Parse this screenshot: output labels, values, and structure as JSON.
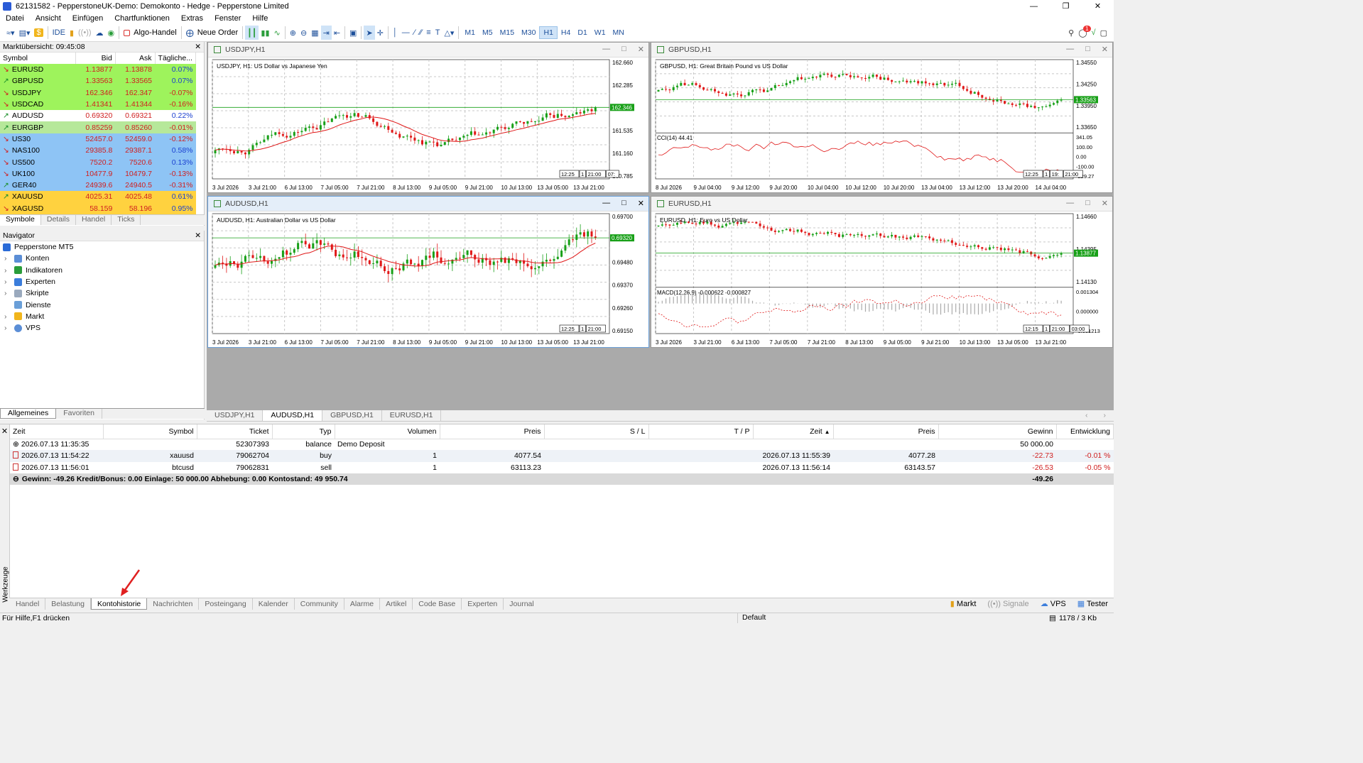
{
  "title": {
    "text": "62131582 - PepperstoneUK-Demo: Demokonto - Hedge - Pepperstone Limited"
  },
  "menu": [
    "Datei",
    "Ansicht",
    "Einfügen",
    "Chartfunktionen",
    "Extras",
    "Fenster",
    "Hilfe"
  ],
  "toolbar": {
    "ide": "IDE",
    "algo": "Algo-Handel",
    "new_order": "Neue Order",
    "timeframes": [
      "M1",
      "M5",
      "M15",
      "M30",
      "H1",
      "H4",
      "D1",
      "W1",
      "MN"
    ],
    "active_tf": "H1",
    "notify_count": "1"
  },
  "market_watch": {
    "title": "Marktübersicht: 09:45:08",
    "headers": [
      "Symbol",
      "Bid",
      "Ask",
      "Tägliche..."
    ],
    "rows": [
      {
        "sym": "EURUSD",
        "bid": "1.13877",
        "ask": "1.13878",
        "chg": "0.07%",
        "bg": "#9ef35c",
        "dir": "down"
      },
      {
        "sym": "GBPUSD",
        "bid": "1.33563",
        "ask": "1.33565",
        "chg": "0.07%",
        "bg": "#9ef35c",
        "dir": "up"
      },
      {
        "sym": "USDJPY",
        "bid": "162.346",
        "ask": "162.347",
        "chg": "-0.07%",
        "bg": "#9ef35c",
        "dir": "down"
      },
      {
        "sym": "USDCAD",
        "bid": "1.41341",
        "ask": "1.41344",
        "chg": "-0.16%",
        "bg": "#9ef35c",
        "dir": "down"
      },
      {
        "sym": "AUDUSD",
        "bid": "0.69320",
        "ask": "0.69321",
        "chg": "0.22%",
        "bg": "#ffffff",
        "dir": "up"
      },
      {
        "sym": "EURGBP",
        "bid": "0.85259",
        "ask": "0.85260",
        "chg": "-0.01%",
        "bg": "#b6e89a",
        "dir": "up"
      },
      {
        "sym": "US30",
        "bid": "52457.0",
        "ask": "52459.0",
        "chg": "-0.12%",
        "bg": "#8ec4f5",
        "dir": "down"
      },
      {
        "sym": "NAS100",
        "bid": "29385.8",
        "ask": "29387.1",
        "chg": "0.58%",
        "bg": "#8ec4f5",
        "dir": "down"
      },
      {
        "sym": "US500",
        "bid": "7520.2",
        "ask": "7520.6",
        "chg": "0.13%",
        "bg": "#8ec4f5",
        "dir": "down"
      },
      {
        "sym": "UK100",
        "bid": "10477.9",
        "ask": "10479.7",
        "chg": "-0.13%",
        "bg": "#8ec4f5",
        "dir": "down"
      },
      {
        "sym": "GER40",
        "bid": "24939.6",
        "ask": "24940.5",
        "chg": "-0.31%",
        "bg": "#8ec4f5",
        "dir": "up"
      },
      {
        "sym": "XAUUSD",
        "bid": "4025.31",
        "ask": "4025.48",
        "chg": "0.61%",
        "bg": "#ffd23f",
        "dir": "up"
      },
      {
        "sym": "XAGUSD",
        "bid": "58.159",
        "ask": "58.196",
        "chg": "0.95%",
        "bg": "#ffd23f",
        "dir": "down"
      }
    ],
    "tabs": [
      "Symbole",
      "Details",
      "Handel",
      "Ticks"
    ]
  },
  "navigator": {
    "title": "Navigator",
    "root": "Pepperstone MT5",
    "items": [
      "Konten",
      "Indikatoren",
      "Experten",
      "Skripte",
      "Dienste",
      "Markt",
      "VPS"
    ],
    "tabs": [
      "Allgemeines",
      "Favoriten"
    ]
  },
  "charts": [
    {
      "title": "USDJPY,H1",
      "label": "USDJPY, H1:  US Dollar vs Japanese Yen",
      "prices": [
        "162.660",
        "162.285",
        "161.910",
        "161.535",
        "161.160",
        "160.785"
      ],
      "last": "162.346",
      "dates": [
        "3 Jul 2026",
        "3 Jul 21:00",
        "6 Jul 13:00",
        "7 Jul 05:00",
        "7 Jul 21:00",
        "8 Jul 13:00",
        "9 Jul 05:00",
        "9 Jul 21:00",
        "10 Jul 13:00",
        "13 Jul 05:00",
        "13 Jul 21:00"
      ],
      "markers": [
        "12:25",
        "1",
        "21:00",
        "07:"
      ]
    },
    {
      "title": "GBPUSD,H1",
      "label": "GBPUSD, H1:  Great Britain Pound vs US Dollar",
      "prices": [
        "1.34550",
        "1.34250",
        "1.33950",
        "1.33650"
      ],
      "last": "1.33563",
      "sub": "CCI(14) 44.41",
      "subprices": [
        "341.05",
        "100.00",
        "0.00",
        "-100.00",
        "-229.27"
      ],
      "dates": [
        "8 Jul 2026",
        "9 Jul 04:00",
        "9 Jul 12:00",
        "9 Jul 20:00",
        "10 Jul 04:00",
        "10 Jul 12:00",
        "10 Jul 20:00",
        "13 Jul 04:00",
        "13 Jul 12:00",
        "13 Jul 20:00",
        "14 Jul 04:00"
      ],
      "markers": [
        "12:25",
        "1",
        "19:",
        "21:00"
      ]
    },
    {
      "title": "AUDUSD,H1",
      "label": "AUDUSD, H1:  Australian Dollar vs US Dollar",
      "prices": [
        "0.69700",
        "0.69590",
        "0.69480",
        "0.69370",
        "0.69260",
        "0.69150"
      ],
      "last": "0.69320",
      "dates": [
        "3 Jul 2026",
        "3 Jul 21:00",
        "6 Jul 13:00",
        "7 Jul 05:00",
        "7 Jul 21:00",
        "8 Jul 13:00",
        "9 Jul 05:00",
        "9 Jul 21:00",
        "10 Jul 13:00",
        "13 Jul 05:00",
        "13 Jul 21:00"
      ],
      "markers": [
        "12:25",
        "1",
        "21:00"
      ]
    },
    {
      "title": "EURUSD,H1",
      "label": "EURUSD, H1:  Euro vs US Dollar",
      "prices": [
        "1.14660",
        "1.14395",
        "1.14130"
      ],
      "last": "1.13877",
      "sub": "MACD(12,26,9) -0.000622 -0.000827",
      "subprices": [
        "0.001304",
        "0.000000",
        "-0.001213"
      ],
      "dates": [
        "3 Jul 2026",
        "3 Jul 21:00",
        "6 Jul 13:00",
        "7 Jul 05:00",
        "7 Jul 21:00",
        "8 Jul 13:00",
        "9 Jul 05:00",
        "9 Jul 21:00",
        "10 Jul 13:00",
        "13 Jul 05:00",
        "13 Jul 21:00"
      ],
      "markers": [
        "12:15",
        "1",
        "21:00",
        "03:00"
      ]
    }
  ],
  "chart_tabs": [
    "USDJPY,H1",
    "AUDUSD,H1",
    "GBPUSD,H1",
    "EURUSD,H1"
  ],
  "active_chart_tab": "AUDUSD,H1",
  "history": {
    "headers": [
      "Zeit",
      "Symbol",
      "Ticket",
      "Typ",
      "Volumen",
      "Preis",
      "S / L",
      "T / P",
      "Zeit",
      "Preis",
      "Gewinn",
      "Entwicklung"
    ],
    "rows": [
      {
        "time": "2026.07.13 11:35:35",
        "symbol": "",
        "ticket": "52307393",
        "type": "balance",
        "vol": "Demo Deposit",
        "price": "",
        "sl": "",
        "tp": "",
        "time2": "",
        "price2": "",
        "profit": "50 000.00",
        "dev": "",
        "red": false
      },
      {
        "time": "2026.07.13 11:54:22",
        "symbol": "xauusd",
        "ticket": "79062704",
        "type": "buy",
        "vol": "1",
        "price": "4077.54",
        "sl": "",
        "tp": "",
        "time2": "2026.07.13 11:55:39",
        "price2": "4077.28",
        "profit": "-22.73",
        "dev": "-0.01 %",
        "red": true
      },
      {
        "time": "2026.07.13 11:56:01",
        "symbol": "btcusd",
        "ticket": "79062831",
        "type": "sell",
        "vol": "1",
        "price": "63113.23",
        "sl": "",
        "tp": "",
        "time2": "2026.07.13 11:56:14",
        "price2": "63143.57",
        "profit": "-26.53",
        "dev": "-0.05 %",
        "red": true
      }
    ],
    "summary": "Gewinn: -49.26  Kredit/Bonus: 0.00  Einlage: 50 000.00  Abhebung: 0.00  Kontostand: 49 950.74",
    "summary_total": "-49.26"
  },
  "toolbox_label": "Werkzeuge",
  "bottom_tabs": [
    "Handel",
    "Belastung",
    "Kontohistorie",
    "Nachrichten",
    "Posteingang",
    "Kalender",
    "Community",
    "Alarme",
    "Artikel",
    "Code Base",
    "Experten",
    "Journal"
  ],
  "active_bottom_tab": "Kontohistorie",
  "bottom_right": [
    "Markt",
    "Signale",
    "VPS",
    "Tester"
  ],
  "status": {
    "help": "Für Hilfe,F1 drücken",
    "profile": "Default",
    "traffic": "1178 / 3 Kb"
  }
}
